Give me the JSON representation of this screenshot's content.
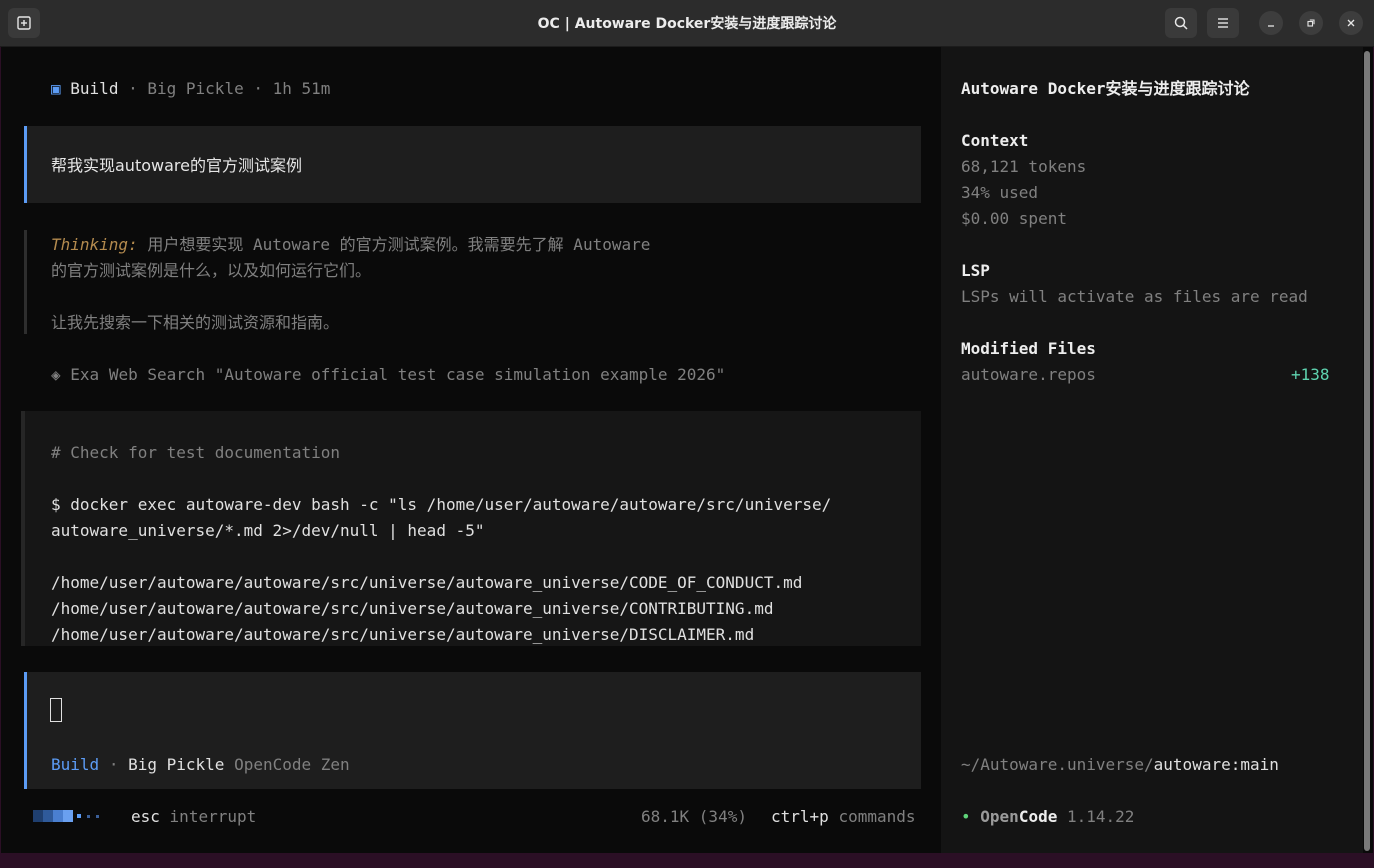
{
  "window": {
    "title": "OC | Autoware Docker安装与进度跟踪讨论"
  },
  "header": {
    "mode_icon": "▣",
    "mode": "Build",
    "sep": "·",
    "model": "Big Pickle",
    "duration": "1h 51m"
  },
  "user_message": "帮我实现autoware的官方测试案例",
  "thinking": {
    "label": "Thinking:",
    "line1": "用户想要实现 Autoware 的官方测试案例。我需要先了解 Autoware",
    "line2": "的官方测试案例是什么，以及如何运行它们。",
    "line3": "让我先搜索一下相关的测试资源和指南。"
  },
  "tool_call": {
    "icon": "◈",
    "text": "Exa Web Search \"Autoware official test case simulation example 2026\""
  },
  "bash": {
    "comment": "# Check for test documentation",
    "cmd_line1": "$ docker exec autoware-dev bash -c \"ls /home/user/autoware/autoware/src/universe/",
    "cmd_line2": "autoware_universe/*.md 2>/dev/null | head -5\"",
    "output": [
      "/home/user/autoware/autoware/src/universe/autoware_universe/CODE_OF_CONDUCT.md",
      "/home/user/autoware/autoware/src/universe/autoware_universe/CONTRIBUTING.md",
      "/home/user/autoware/autoware/src/universe/autoware_universe/DISCLAIMER.md"
    ]
  },
  "input": {
    "mode": "Build",
    "sep": "·",
    "model": "Big Pickle",
    "provider": "OpenCode Zen"
  },
  "status": {
    "key1": "esc",
    "label1": "interrupt",
    "tokens": "68.1K (34%)",
    "key2": "ctrl+p",
    "label2": "commands"
  },
  "sidebar": {
    "session_title": "Autoware Docker安装与进度跟踪讨论",
    "context_heading": "Context",
    "tokens": "68,121 tokens",
    "used": "34% used",
    "spent": "$0.00 spent",
    "lsp_heading": "LSP",
    "lsp_text": "LSPs will activate as files are read",
    "modified_heading": "Modified Files",
    "modified_file": "autoware.repos",
    "modified_delta": "+138",
    "path_prefix": "~/Autoware.universe/",
    "branch": "autoware:main",
    "app_dot": "•",
    "app_name_a": "Open",
    "app_name_b": "Code",
    "version": "1.14.22"
  },
  "colors": {
    "accent": "#5c9cf5",
    "added": "#5fd4b0",
    "app_dot": "#5fd47a",
    "background": "#0a0a0a"
  }
}
